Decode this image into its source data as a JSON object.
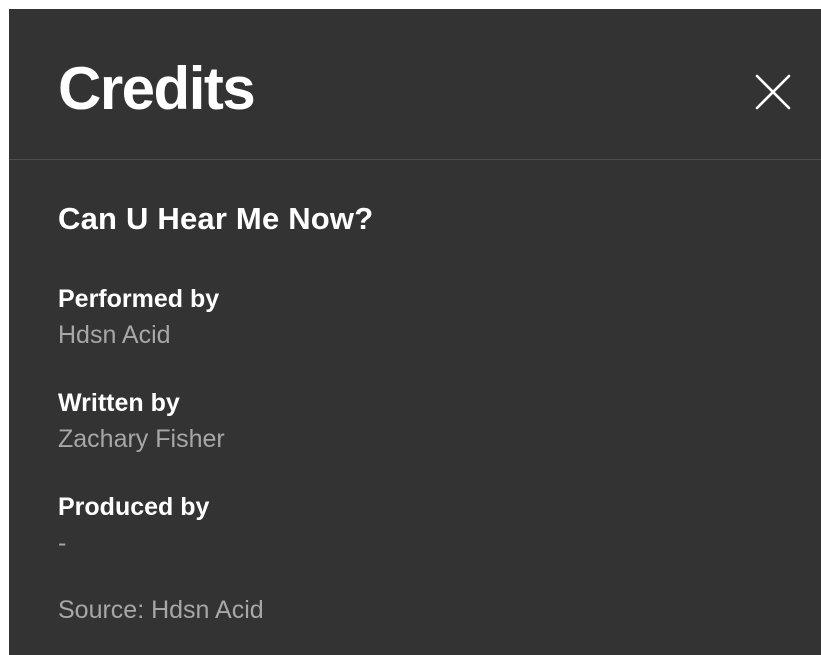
{
  "dialog": {
    "title": "Credits",
    "close_icon": "close-icon"
  },
  "track": {
    "title": "Can U Hear Me Now?"
  },
  "credits": [
    {
      "label": "Performed by",
      "value": "Hdsn Acid"
    },
    {
      "label": "Written by",
      "value": "Zachary Fisher"
    },
    {
      "label": "Produced by",
      "value": "-"
    }
  ],
  "source": "Source: Hdsn Acid",
  "colors": {
    "background": "#333333",
    "divider": "#4e4e4e",
    "primary_text": "#ffffff",
    "secondary_text": "#a7a7a7"
  }
}
